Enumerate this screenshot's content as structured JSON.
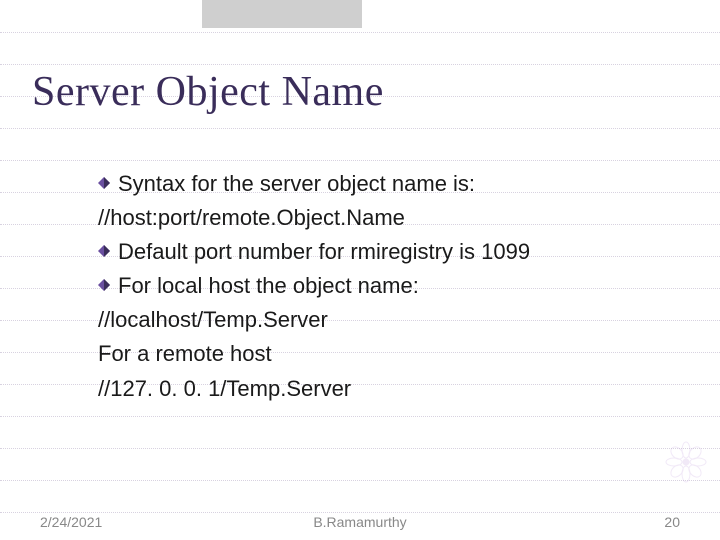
{
  "title": "Server Object Name",
  "bullets": [
    {
      "kind": "diamond",
      "text": "Syntax for the server object name is:"
    },
    {
      "kind": "plain",
      "text": "//host:port/remote.Object.Name"
    },
    {
      "kind": "diamond",
      "text": "Default port number for rmiregistry is 1099"
    },
    {
      "kind": "diamond",
      "text": "For local host the object name:"
    },
    {
      "kind": "plain",
      "text": "//localhost/Temp.Server"
    },
    {
      "kind": "plain",
      "text": "For a remote host"
    },
    {
      "kind": "plain",
      "text": "//127. 0. 0. 1/Temp.Server"
    }
  ],
  "footer": {
    "date": "2/24/2021",
    "author": "B.Ramamurthy",
    "pagenum": "20"
  }
}
